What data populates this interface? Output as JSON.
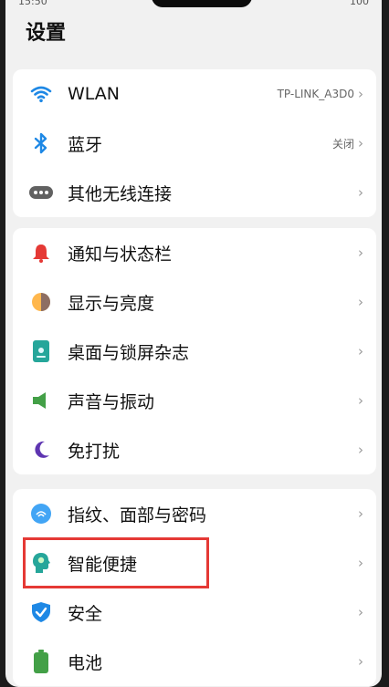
{
  "status": {
    "time": "15:50",
    "battery": "100"
  },
  "title": "设置",
  "group1": [
    {
      "label": "WLAN",
      "value": "TP-LINK_A3D0",
      "icon": "wifi-icon"
    },
    {
      "label": "蓝牙",
      "value": "关闭",
      "icon": "bluetooth-icon"
    },
    {
      "label": "其他无线连接",
      "value": "",
      "icon": "more-connections-icon"
    }
  ],
  "group2": [
    {
      "label": "通知与状态栏",
      "icon": "bell-icon"
    },
    {
      "label": "显示与亮度",
      "icon": "brightness-icon"
    },
    {
      "label": "桌面与锁屏杂志",
      "icon": "wallpaper-icon"
    },
    {
      "label": "声音与振动",
      "icon": "speaker-icon"
    },
    {
      "label": "免打扰",
      "icon": "moon-icon"
    }
  ],
  "group3": [
    {
      "label": "指纹、面部与密码",
      "icon": "fingerprint-icon"
    },
    {
      "label": "智能便捷",
      "icon": "smart-assist-icon"
    },
    {
      "label": "安全",
      "icon": "shield-icon"
    },
    {
      "label": "电池",
      "icon": "battery-icon"
    }
  ],
  "chevron": "›",
  "colors": {
    "highlight": "#e53935",
    "wifi": "#1e88e5",
    "bell": "#e53935",
    "sound": "#43a047",
    "moon": "#5e35b1"
  }
}
